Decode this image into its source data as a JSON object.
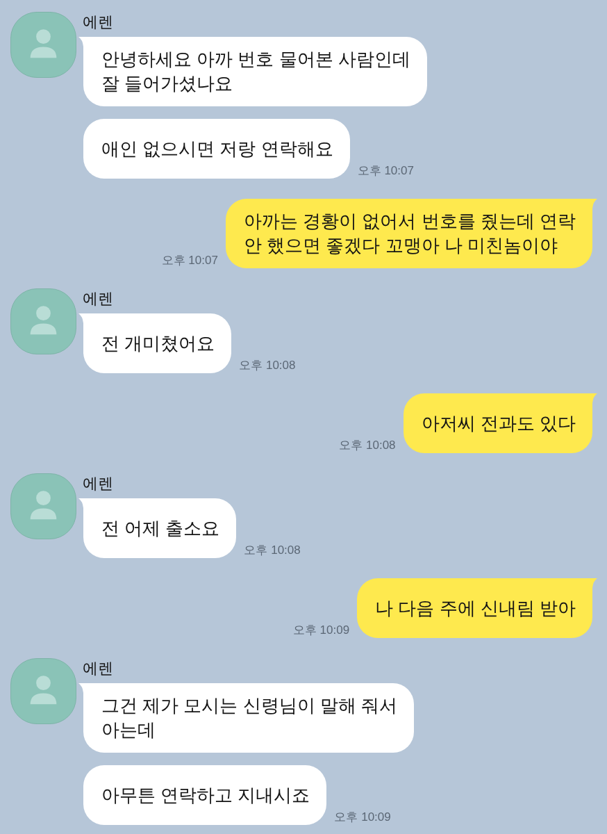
{
  "chat": {
    "groups": [
      {
        "kind": "received",
        "sender": "에렌",
        "messages": [
          {
            "text": "안녕하세요 아까 번호 물어본 사람인데\n잘 들어가셨나요"
          },
          {
            "text": "애인 없으시면 저랑 연락해요",
            "time": "오후 10:07"
          }
        ]
      },
      {
        "kind": "sent",
        "messages": [
          {
            "text": "아까는 경황이 없어서 번호를 줬는데 연락\n안 했으면 좋겠다 꼬맹아 나 미친놈이야",
            "time": "오후 10:07"
          }
        ]
      },
      {
        "kind": "received",
        "sender": "에렌",
        "messages": [
          {
            "text": "전 개미쳤어요",
            "time": "오후 10:08"
          }
        ]
      },
      {
        "kind": "sent",
        "messages": [
          {
            "text": "아저씨 전과도 있다",
            "time": "오후 10:08"
          }
        ]
      },
      {
        "kind": "received",
        "sender": "에렌",
        "messages": [
          {
            "text": "전 어제 출소요",
            "time": "오후 10:08"
          }
        ]
      },
      {
        "kind": "sent",
        "messages": [
          {
            "text": "나 다음 주에 신내림 받아",
            "time": "오후 10:09"
          }
        ]
      },
      {
        "kind": "received",
        "sender": "에렌",
        "messages": [
          {
            "text": "그건 제가 모시는 신령님이 말해 줘서\n아는데"
          },
          {
            "text": "아무튼 연락하고 지내시죠",
            "time": "오후 10:09"
          }
        ]
      }
    ]
  }
}
